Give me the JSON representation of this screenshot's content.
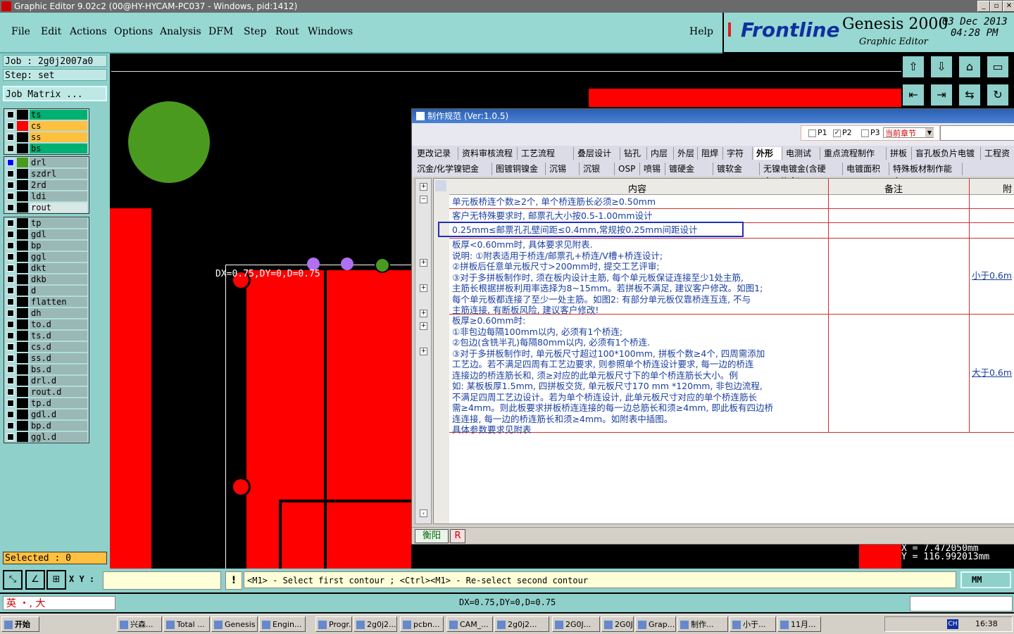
{
  "window": {
    "title": "Graphic Editor 9.02c2 (00@HY-HYCAM-PC037 - Windows, pid:1412)"
  },
  "menu": [
    "File",
    "Edit",
    "Actions",
    "Options",
    "Analysis",
    "DFM",
    "Step",
    "Rout",
    "Windows"
  ],
  "help": "Help",
  "brand": {
    "logo": "Frontline",
    "product": "Genesis 2000",
    "subtitle": "Graphic Editor",
    "date": "03 Dec 2013",
    "time": "04:28 PM"
  },
  "job": {
    "job": "Job : 2g0j2007a0",
    "step": "Step: set",
    "matrix_button": "Job Matrix ..."
  },
  "layers_group1": [
    {
      "name": "ts",
      "color": "#00b070"
    },
    {
      "name": "cs",
      "color": "#ffc040"
    },
    {
      "name": "ss",
      "color": "#ffc040"
    },
    {
      "name": "bs",
      "color": "#00b070"
    }
  ],
  "layers_group2": [
    "drl",
    "szdrl",
    "2rd",
    "ldi",
    "rout"
  ],
  "layers_group3": [
    "tp",
    "gdl",
    "bp",
    "ggl",
    "dkt",
    "dkb",
    "d",
    "flatten",
    "dh",
    "to.d",
    "ts.d",
    "cs.d",
    "ss.d",
    "bs.d",
    "drl.d",
    "rout.d",
    "tp.d",
    "gdl.d",
    "bp.d",
    "ggl.d"
  ],
  "selected": "Selected : 0",
  "canvas": {
    "measure": "DX=0.75,DY=0,D=0.75"
  },
  "coords": {
    "x": "X = 7.472050mm",
    "y": "Y = 116.992013mm"
  },
  "dialog": {
    "title": "制作规范 (Ver:1.0.5)",
    "checks": [
      "P1",
      "P2",
      "P3"
    ],
    "dropdown": "当前章节",
    "tabs_row1": [
      "更改记录",
      "资料审核流程",
      "工艺流程",
      "叠层设计",
      "钻孔",
      "内层",
      "外层",
      "阻焊",
      "字符",
      "外形",
      "电测试",
      "重点流程制作",
      "拼板",
      "盲孔板负片电镀",
      "工程资"
    ],
    "tabs_row2": [
      "沉金/化学镍钯金",
      "图镀铜镍金",
      "沉锡",
      "沉银",
      "OSP",
      "喷锡",
      "镀硬金",
      "镀软金",
      "无镍电镀金(含硬金、软金)",
      "电镀面积",
      "特殊板材制作能力"
    ],
    "headers": [
      "内容",
      "备注",
      "附"
    ],
    "rows": [
      {
        "content": "单元板桥连个数≥2个, 单个桥连筋长必须≥0.50mm"
      },
      {
        "content": "客户无特殊要求时, 邮票孔大小按0.5-1.00mm设计"
      },
      {
        "content": "0.25mm≤邮票孔孔壁间距≤0.4mm,常规按0.25mm间距设计"
      },
      {
        "content": "板厚<0.60mm时, 具体要求见附表.\n说明: ①附表适用于桥连/邮票孔+桥连/V槽+桥连设计;\n②拼板后任意单元板尺寸>200mm时, 提交工艺评审;\n③对于多拼板制作时, 须在板内设计主筋, 每个单元板保证连接至少1处主筋,\n主筋长根据拼板利用率选择为8~15mm。若拼板不满足, 建议客户修改。如图1;\n每个单元板都连接了至少一处主筋。如图2: 有部分单元板仅靠桥连互连, 不与\n主筋连接, 有断板风险, 建议客户修改!",
        "link": "小于0.6m"
      },
      {
        "content": "板厚≥0.60mm时:\n①非包边每隔100mm以内, 必须有1个桥连;\n②包边(含铣半孔)每隔80mm以内, 必须有1个桥连.\n③对于多拼板制作时, 单元板尺寸超过100*100mm, 拼板个数≥4个, 四周需添加\n工艺边。若不满足四周有工艺边要求, 则参照单个桥连设计要求, 每一边的桥连\n连接边的桥连筋长和, 须≥对应的此单元板尺寸下的单个桥连筋长大小。例\n如: 某板板厚1.5mm, 四拼板交货, 单元板尺寸170 mm *120mm, 非包边流程,\n不满足四周工艺边设计。若为单个桥连设计, 此单元板尺寸对应的单个桥连筋长\n需≥4mm。则此板要求拼板桥连连接的每一边总筋长和须≥4mm, 即此板有四边桥\n连连接, 每一边的桥连筋长和须≥4mm。如附表中插图。\n具体参数要求见附表",
        "link": "大于0.6m"
      }
    ],
    "footer_tabs": [
      "衡阳",
      "R"
    ]
  },
  "command": {
    "xy_label": "X Y :",
    "xy_value": "",
    "prompt": "<M1> - Select first contour ; <Ctrl><M1> - Re-select second contour",
    "units": "MM"
  },
  "status": {
    "ime": "英 ・, 大",
    "text": "DX=0.75,DY=0,D=0.75"
  },
  "taskbar": {
    "start": "开始",
    "tasks": [
      "兴森...",
      "Total ...",
      "Genesis",
      "Engin...",
      "Progr...",
      "2g0j2...",
      "pcbn...",
      "CAM_...",
      "2g0j2...",
      "2G0J...",
      "2G0J...",
      "Grap...",
      "制作...",
      "小于...",
      "11月..."
    ],
    "clock": "16:38",
    "tray_lang": "CH"
  }
}
